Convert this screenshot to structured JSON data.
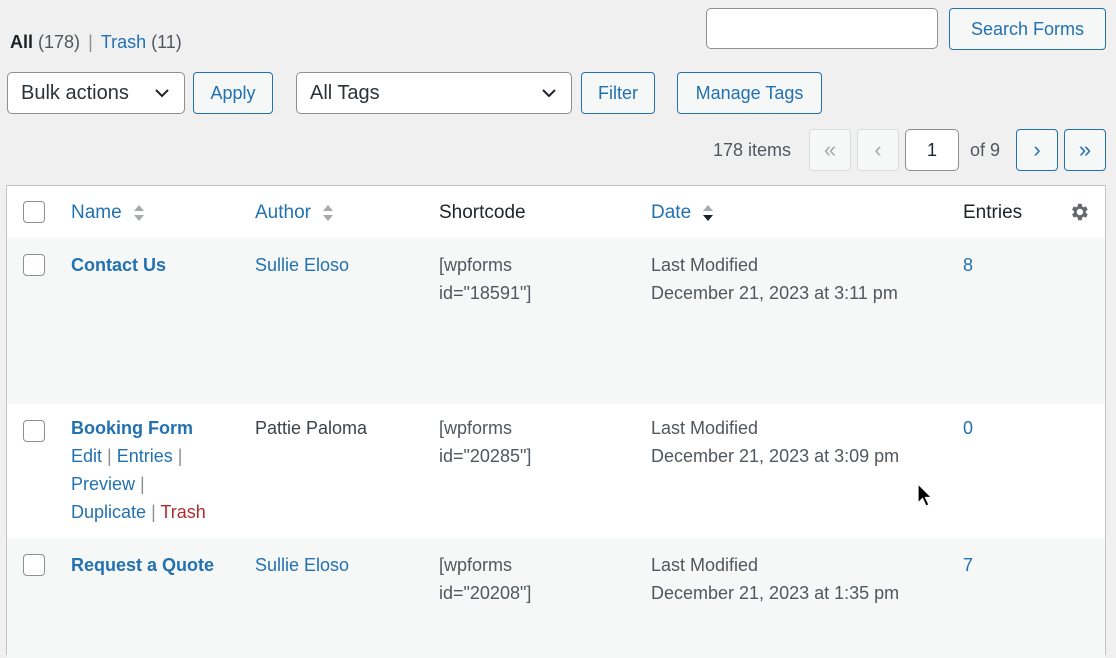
{
  "views": {
    "all_label": "All",
    "all_count": "(178)",
    "separator": "|",
    "trash_label": "Trash",
    "trash_count": "(11)"
  },
  "search": {
    "value": "",
    "button_label": "Search Forms"
  },
  "toolbar": {
    "bulk_actions": "Bulk actions",
    "apply_label": "Apply",
    "tags_filter": "All Tags",
    "filter_label": "Filter",
    "manage_tags_label": "Manage Tags"
  },
  "pagination": {
    "items_text": "178 items",
    "first": "«",
    "prev": "‹",
    "current_page": "1",
    "of_text": "of 9",
    "next": "›",
    "last": "»"
  },
  "table": {
    "columns": {
      "name": "Name",
      "author": "Author",
      "shortcode": "Shortcode",
      "date": "Date",
      "entries": "Entries"
    },
    "rows": [
      {
        "name": "Contact Us",
        "author": "Sullie Eloso",
        "shortcode_line1": "[wpforms",
        "shortcode_line2": "id=\"18591\"]",
        "date_line1": "Last Modified",
        "date_line2": "December 21, 2023 at 3:11 pm",
        "entries": "8"
      },
      {
        "name": "Booking Form",
        "author": "Pattie Paloma",
        "shortcode_line1": "[wpforms",
        "shortcode_line2": "id=\"20285\"]",
        "date_line1": "Last Modified",
        "date_line2": "December 21, 2023 at 3:09 pm",
        "entries": "0",
        "actions": {
          "edit": "Edit",
          "entries": "Entries",
          "preview": "Preview",
          "duplicate": "Duplicate",
          "trash": "Trash",
          "bar": "|"
        }
      },
      {
        "name": "Request a Quote",
        "author": "Sullie Eloso",
        "shortcode_line1": "[wpforms",
        "shortcode_line2": "id=\"20208\"]",
        "date_line1": "Last Modified",
        "date_line2": "December 21, 2023 at 1:35 pm",
        "entries": "7"
      }
    ]
  },
  "icons": {
    "sort": "sort-arrows-icon",
    "sort_desc": "sort-desc-icon",
    "settings": "gear-icon",
    "dropdown": "chevron-down-icon",
    "cursor": "mouse-pointer-icon"
  },
  "colors": {
    "link": "#2271b1",
    "trash": "#b32d2e",
    "background": "#f0f0f1"
  }
}
